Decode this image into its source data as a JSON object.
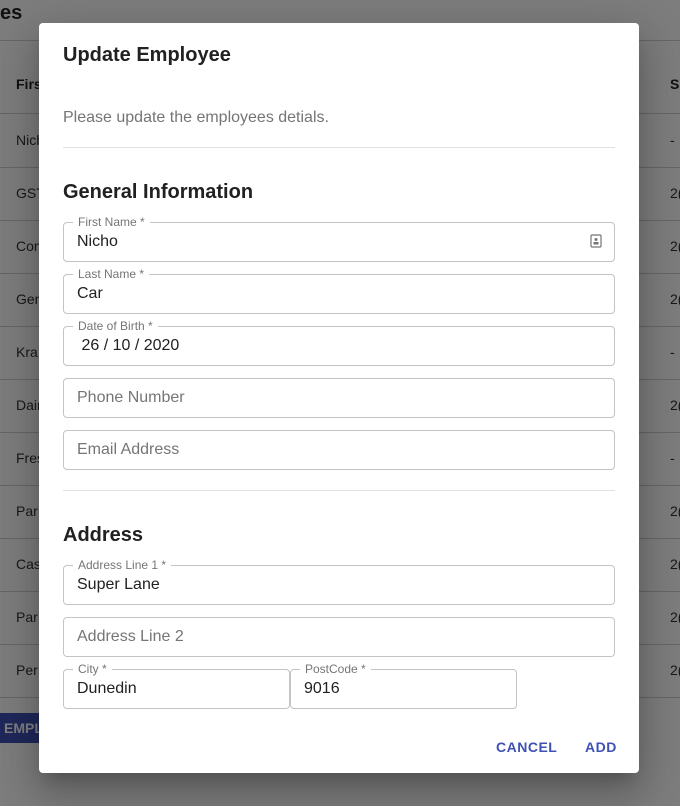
{
  "background": {
    "title": "es",
    "table": {
      "col_first": "Firs",
      "col_s": "S",
      "rows": [
        {
          "c1": "Nich",
          "c2": "-"
        },
        {
          "c1": "GST",
          "c2": "2("
        },
        {
          "c1": "Con",
          "c2": "2("
        },
        {
          "c1": "Gen",
          "c2": "2("
        },
        {
          "c1": "Kra",
          "c2": "-"
        },
        {
          "c1": "Dair",
          "c2": "2("
        },
        {
          "c1": "Fres",
          "c2": "-"
        },
        {
          "c1": "Par",
          "c2": "2("
        },
        {
          "c1": "Cas",
          "c2": "2("
        },
        {
          "c1": "Par",
          "c2": "2("
        },
        {
          "c1": "Per",
          "c2": "2("
        }
      ]
    },
    "add_button_partial": "EMPL"
  },
  "dialog": {
    "title": "Update Employee",
    "description": "Please update the employees detials.",
    "general_section": "General Information",
    "first_name": {
      "label": "First Name *",
      "value": "Nicho"
    },
    "last_name": {
      "label": "Last Name *",
      "value": "Car"
    },
    "dob": {
      "label": "Date of Birth *",
      "value": " 26 / 10 / 2020"
    },
    "phone": {
      "placeholder": "Phone Number"
    },
    "email": {
      "placeholder": "Email Address"
    },
    "address_section": "Address",
    "address1": {
      "label": "Address Line 1 *",
      "value": "Super Lane"
    },
    "address2": {
      "placeholder": "Address Line 2"
    },
    "city": {
      "label": "City *",
      "value": "Dunedin"
    },
    "postcode": {
      "label": "PostCode *",
      "value": "9016"
    },
    "cancel_label": "CANCEL",
    "add_label": "ADD"
  },
  "colors": {
    "primary": "#3f51b5"
  },
  "icons": {
    "first_name_field": "contact-card-icon"
  }
}
